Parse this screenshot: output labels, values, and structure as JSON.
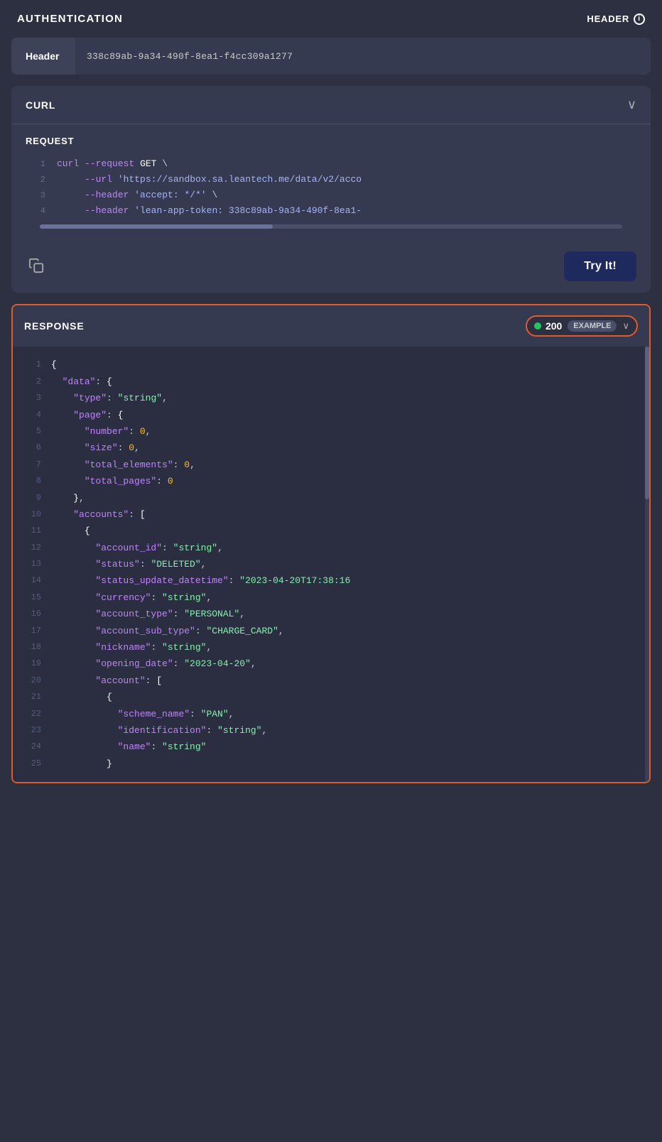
{
  "auth": {
    "title": "AUTHENTICATION",
    "header_label": "HEADER",
    "info_icon": "i",
    "token_label": "Header",
    "token_value": "338c89ab-9a34-490f-8ea1-f4cc309a1277"
  },
  "curl": {
    "title": "CURL",
    "chevron": "∨",
    "request_title": "REQUEST",
    "code_lines": [
      {
        "num": "1",
        "content": "curl --request GET \\"
      },
      {
        "num": "2",
        "content": "     --url 'https://sandbox.sa.leantech.me/data/v2/acco"
      },
      {
        "num": "3",
        "content": "     --header 'accept: */*' \\"
      },
      {
        "num": "4",
        "content": "     --header 'lean-app-token: 338c89ab-9a34-490f-8ea1-"
      }
    ],
    "copy_label": "copy",
    "try_it_label": "Try It!"
  },
  "response": {
    "title": "RESPONSE",
    "status_code": "200",
    "example_badge": "EXAMPLE",
    "dropdown_arrow": "∨",
    "json_lines": [
      {
        "num": "1",
        "content": "{"
      },
      {
        "num": "2",
        "content": "  \"data\": {"
      },
      {
        "num": "3",
        "content": "    \"type\": \"string\","
      },
      {
        "num": "4",
        "content": "    \"page\": {"
      },
      {
        "num": "5",
        "content": "      \"number\": 0,"
      },
      {
        "num": "6",
        "content": "      \"size\": 0,"
      },
      {
        "num": "7",
        "content": "      \"total_elements\": 0,"
      },
      {
        "num": "8",
        "content": "      \"total_pages\": 0"
      },
      {
        "num": "9",
        "content": "    },"
      },
      {
        "num": "10",
        "content": "    \"accounts\": ["
      },
      {
        "num": "11",
        "content": "      {"
      },
      {
        "num": "12",
        "content": "        \"account_id\": \"string\","
      },
      {
        "num": "13",
        "content": "        \"status\": \"DELETED\","
      },
      {
        "num": "14",
        "content": "        \"status_update_datetime\": \"2023-04-20T17:38:16"
      },
      {
        "num": "15",
        "content": "        \"currency\": \"string\","
      },
      {
        "num": "16",
        "content": "        \"account_type\": \"PERSONAL\","
      },
      {
        "num": "17",
        "content": "        \"account_sub_type\": \"CHARGE_CARD\","
      },
      {
        "num": "18",
        "content": "        \"nickname\": \"string\","
      },
      {
        "num": "19",
        "content": "        \"opening_date\": \"2023-04-20\","
      },
      {
        "num": "20",
        "content": "        \"account\": ["
      },
      {
        "num": "21",
        "content": "          {"
      },
      {
        "num": "22",
        "content": "            \"scheme_name\": \"PAN\","
      },
      {
        "num": "23",
        "content": "            \"identification\": \"string\","
      },
      {
        "num": "24",
        "content": "            \"name\": \"string\""
      },
      {
        "num": "25",
        "content": "          }"
      }
    ]
  }
}
